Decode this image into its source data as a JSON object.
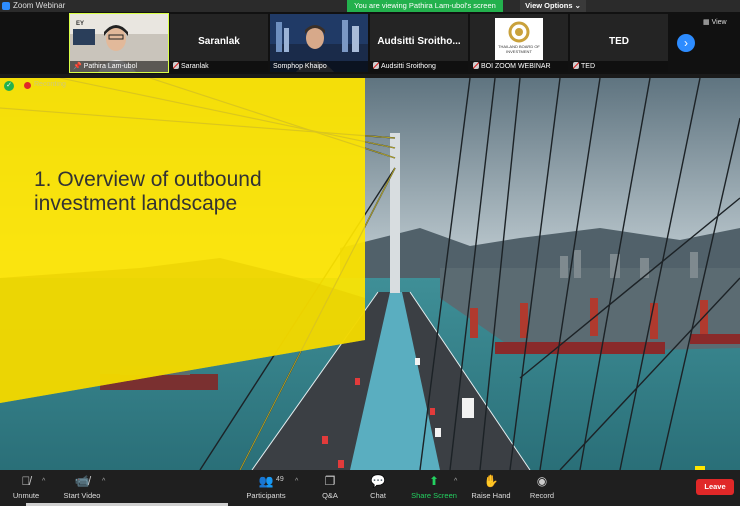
{
  "window": {
    "title": "Zoom Webinar"
  },
  "banner": {
    "text": "You are viewing Pathira Lam-ubol's screen",
    "view_options": "View Options ⌄"
  },
  "participants": [
    {
      "name": "Pathira Lam-ubol",
      "big_name": "",
      "muted": false,
      "pinned": true,
      "has_video": true
    },
    {
      "name": "Saranlak",
      "big_name": "Saranlak",
      "muted": true,
      "pinned": false,
      "has_video": false
    },
    {
      "name": "Somphop Khaipo",
      "big_name": "",
      "muted": false,
      "pinned": false,
      "has_video": true
    },
    {
      "name": "Audsitti Sroithong",
      "big_name": "Audsitti Sroitho...",
      "muted": true,
      "pinned": false,
      "has_video": false
    },
    {
      "name": "BOI ZOOM WEBINAR",
      "big_name": "",
      "muted": true,
      "pinned": false,
      "has_video": true,
      "logo_text": "THAILAND BOARD OF INVESTMENT"
    },
    {
      "name": "TED",
      "big_name": "TED",
      "muted": true,
      "pinned": false,
      "has_video": false
    }
  ],
  "filmstrip": {
    "next_arrow": "›",
    "view_label": "View"
  },
  "recording": {
    "label": "Recording"
  },
  "slide": {
    "title": "1. Overview of outbound investment landscape"
  },
  "toolbar": {
    "unmute": "Unmute",
    "start_video": "Start Video",
    "participants": "Participants",
    "participants_count": "49",
    "qa": "Q&A",
    "chat": "Chat",
    "share_screen": "Share Screen",
    "raise_hand": "Raise Hand",
    "record": "Record",
    "leave": "Leave"
  },
  "colors": {
    "zoom_blue": "#2d8cff",
    "share_green": "#23b14d",
    "ey_yellow": "#ffe600",
    "leave_red": "#e02828"
  }
}
